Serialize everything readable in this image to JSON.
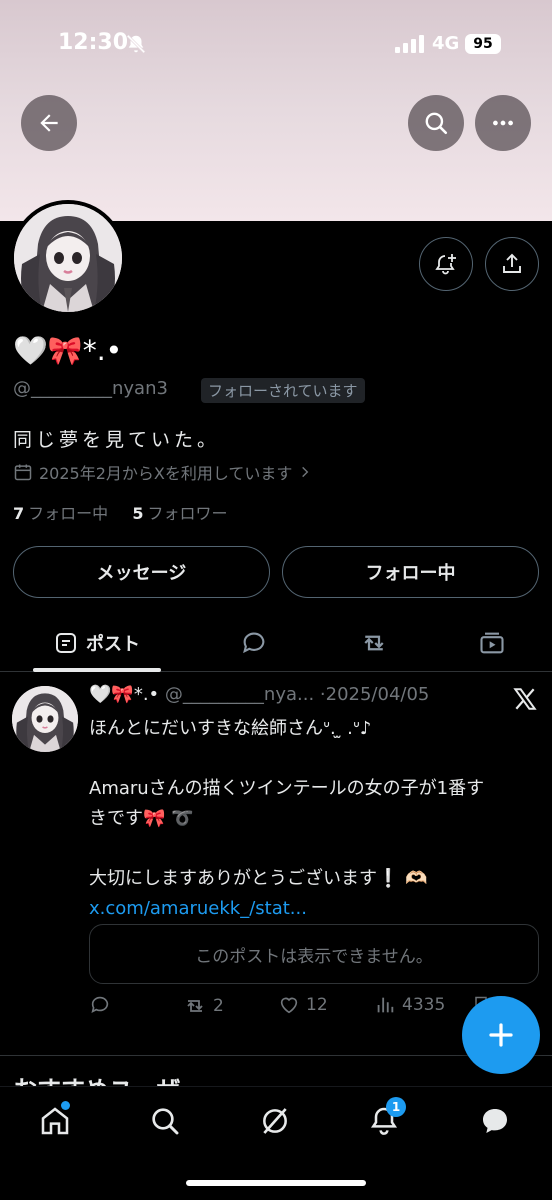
{
  "status_bar": {
    "time": "12:30",
    "network": "4G",
    "battery": "95"
  },
  "profile": {
    "display_name": "🤍🎀*.•",
    "handle": "@_________nyan3",
    "follows_you": "フォローされています",
    "bio": "同じ夢を見ていた。",
    "joined": "2025年2月からXを利用しています",
    "following_count": "7",
    "following_label": "フォロー中",
    "followers_count": "5",
    "followers_label": "フォロワー"
  },
  "buttons": {
    "message": "メッセージ",
    "following": "フォロー中"
  },
  "tabs": {
    "posts": "ポスト"
  },
  "post": {
    "author": "🤍🎀*.•",
    "handle": "@_________nya...",
    "date": "·2025/04/05",
    "lines": [
      "ほんとにだいすきな絵師さんᐡ. ̫ .ᐡ♪",
      "",
      "Amaruさんの描くツインテールの女の子が1番す",
      "きです🎀 ➰",
      "",
      "大切にしますありがとうございます❕ 🫶🏻"
    ],
    "link": "x.com/amaruekk_/stat...",
    "quoted": "このポストは表示できません。",
    "reposts": "2",
    "likes": "12",
    "views": "4335"
  },
  "recommend": {
    "heading": "おすすめユーザー"
  },
  "nav": {
    "notification_badge": "1"
  },
  "colors": {
    "accent": "#1d9bf0",
    "background": "#000000",
    "banner": "#e6dadf"
  }
}
